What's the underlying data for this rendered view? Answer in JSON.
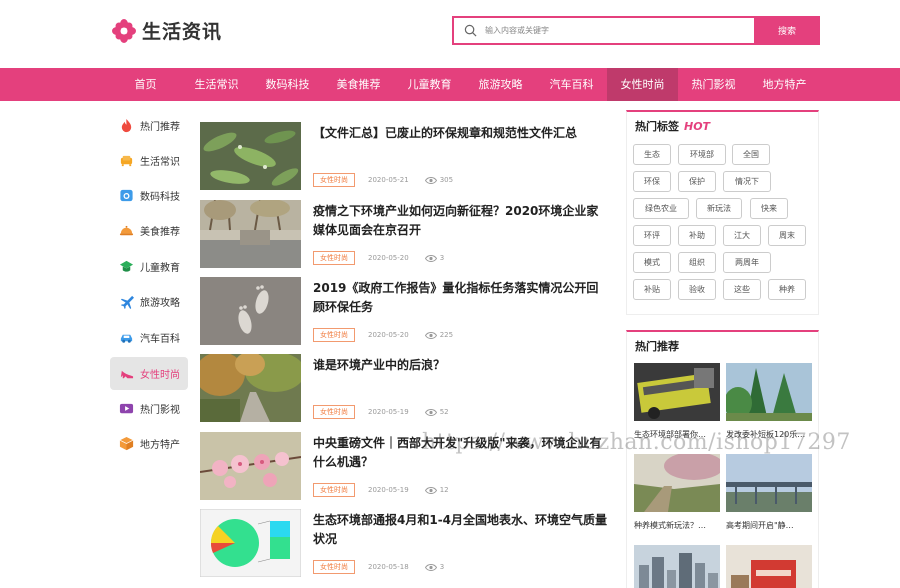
{
  "site": {
    "name": "生活资讯",
    "brand_color": "#e4407d"
  },
  "search": {
    "placeholder": "输入内容或关键字",
    "button": "搜索"
  },
  "nav": [
    {
      "label": "首页"
    },
    {
      "label": "生活常识"
    },
    {
      "label": "数码科技"
    },
    {
      "label": "美食推荐"
    },
    {
      "label": "儿童教育"
    },
    {
      "label": "旅游攻略"
    },
    {
      "label": "汽车百科"
    },
    {
      "label": "女性时尚",
      "active": true
    },
    {
      "label": "热门影视"
    },
    {
      "label": "地方特产"
    }
  ],
  "sidebar": [
    {
      "label": "热门推荐",
      "icon": "fire-icon"
    },
    {
      "label": "生活常识",
      "icon": "sofa-icon"
    },
    {
      "label": "数码科技",
      "icon": "camera-icon"
    },
    {
      "label": "美食推荐",
      "icon": "dish-icon"
    },
    {
      "label": "儿童教育",
      "icon": "graduation-cap-icon"
    },
    {
      "label": "旅游攻略",
      "icon": "airplane-icon"
    },
    {
      "label": "汽车百科",
      "icon": "car-icon"
    },
    {
      "label": "女性时尚",
      "icon": "high-heel-icon",
      "active": true
    },
    {
      "label": "热门影视",
      "icon": "video-icon"
    },
    {
      "label": "地方特产",
      "icon": "box-icon"
    }
  ],
  "articles": [
    {
      "title": "【文件汇总】已废止的环保规章和规范性文件汇总",
      "category": "女性时尚",
      "date": "2020-05-21",
      "views": "305",
      "thumb": "leaves"
    },
    {
      "title": "疫情之下环境产业如何迈向新征程？2020环境企业家媒体见面会在京召开",
      "category": "女性时尚",
      "date": "2020-05-20",
      "views": "3",
      "thumb": "park"
    },
    {
      "title": "2019《政府工作报告》量化指标任务落实情况公开回顾环保任务",
      "category": "女性时尚",
      "date": "2020-05-20",
      "views": "225",
      "thumb": "footprints"
    },
    {
      "title": "谁是环境产业中的后浪？",
      "category": "女性时尚",
      "date": "2020-05-19",
      "views": "52",
      "thumb": "autumn-road"
    },
    {
      "title": "中央重磅文件｜西部大开发\"升级版\"来袭，环境企业有什么机遇？",
      "category": "女性时尚",
      "date": "2020-05-19",
      "views": "12",
      "thumb": "blossom"
    },
    {
      "title": "生态环境部通报4月和1-4月全国地表水、环境空气质量状况",
      "category": "女性时尚",
      "date": "2020-05-18",
      "views": "3",
      "thumb": "pie-chart"
    }
  ],
  "hot_tags": {
    "title": "热门标签",
    "hot_label": "HOT",
    "tags": [
      "生态",
      "环境部",
      "全国",
      "环保",
      "保护",
      "情况下",
      "绿色农业",
      "新玩法",
      "快来",
      "环评",
      "补助",
      "江大",
      "周末",
      "模式",
      "组织",
      "两周年",
      "补贴",
      "验收",
      "这些",
      "种养"
    ]
  },
  "hot_recommend": {
    "title": "热门推荐",
    "items": [
      {
        "caption": "生态环境部部署你…",
        "img": "machine"
      },
      {
        "caption": "发改委补短板120乐…",
        "img": "trees"
      },
      {
        "caption": "种养模式新玩法？…",
        "img": "field"
      },
      {
        "caption": "高考期间开启\"静…",
        "img": "bridge"
      },
      {
        "caption": "",
        "img": "city"
      },
      {
        "caption": "",
        "img": "red-box"
      }
    ]
  },
  "watermark": "https://www.huzhan.com/ishop17297"
}
